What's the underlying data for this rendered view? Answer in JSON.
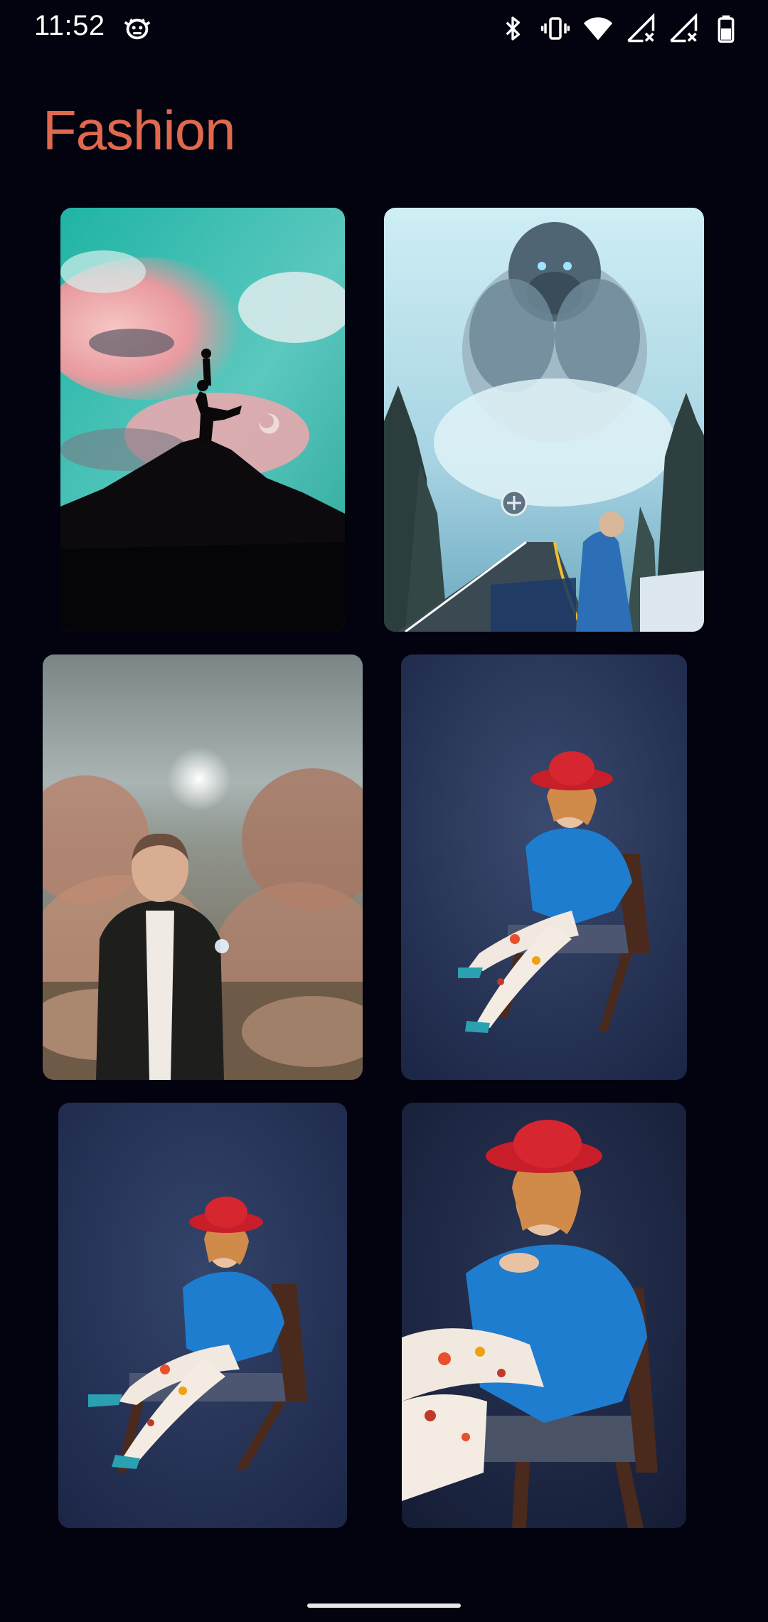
{
  "status_bar": {
    "time": "11:52",
    "icons": [
      "debug-bug-icon",
      "bluetooth-icon",
      "vibrate-icon",
      "wifi-icon",
      "signal-no-data-icon",
      "signal-no-data-icon",
      "battery-icon"
    ]
  },
  "page": {
    "title": "Fashion"
  },
  "colors": {
    "background": "#03030f",
    "title": "#e0694d"
  },
  "gallery": {
    "items": [
      {
        "subject": "couple-silhouette-on-mountain"
      },
      {
        "subject": "giant-gorilla-in-fog-road"
      },
      {
        "subject": "man-in-autumn-forest"
      },
      {
        "subject": "woman-red-hat-chair"
      },
      {
        "subject": "woman-red-hat-chair-variant"
      },
      {
        "subject": "woman-red-hat-chair-closeup"
      }
    ]
  }
}
